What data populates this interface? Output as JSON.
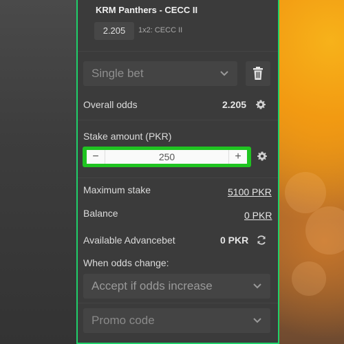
{
  "bet": {
    "match_title": "KRM Panthers - CECC II",
    "odds": "2.205",
    "market": "1x2: CECC II"
  },
  "bet_type": {
    "selected": "Single bet"
  },
  "overall_odds": {
    "label": "Overall odds",
    "value": "2.205"
  },
  "stake": {
    "label": "Stake amount (PKR)",
    "value": "250",
    "minus": "−",
    "plus": "+"
  },
  "maximum_stake": {
    "label": "Maximum stake",
    "value": "5100 PKR"
  },
  "balance": {
    "label": "Balance",
    "value": "0 PKR"
  },
  "advancebet": {
    "label": "Available Advancebet",
    "value": "0 PKR"
  },
  "odds_change": {
    "label": "When odds change:",
    "selected": "Accept if odds increase"
  },
  "promo": {
    "placeholder": "Promo code"
  },
  "colors": {
    "panel_border": "#1fd06a",
    "stepper_highlight": "#1fc421",
    "panel_background": "#3b3b3b"
  },
  "icons": [
    "trash-icon",
    "gear-icon",
    "refresh-icon",
    "chevron-down-icon"
  ]
}
